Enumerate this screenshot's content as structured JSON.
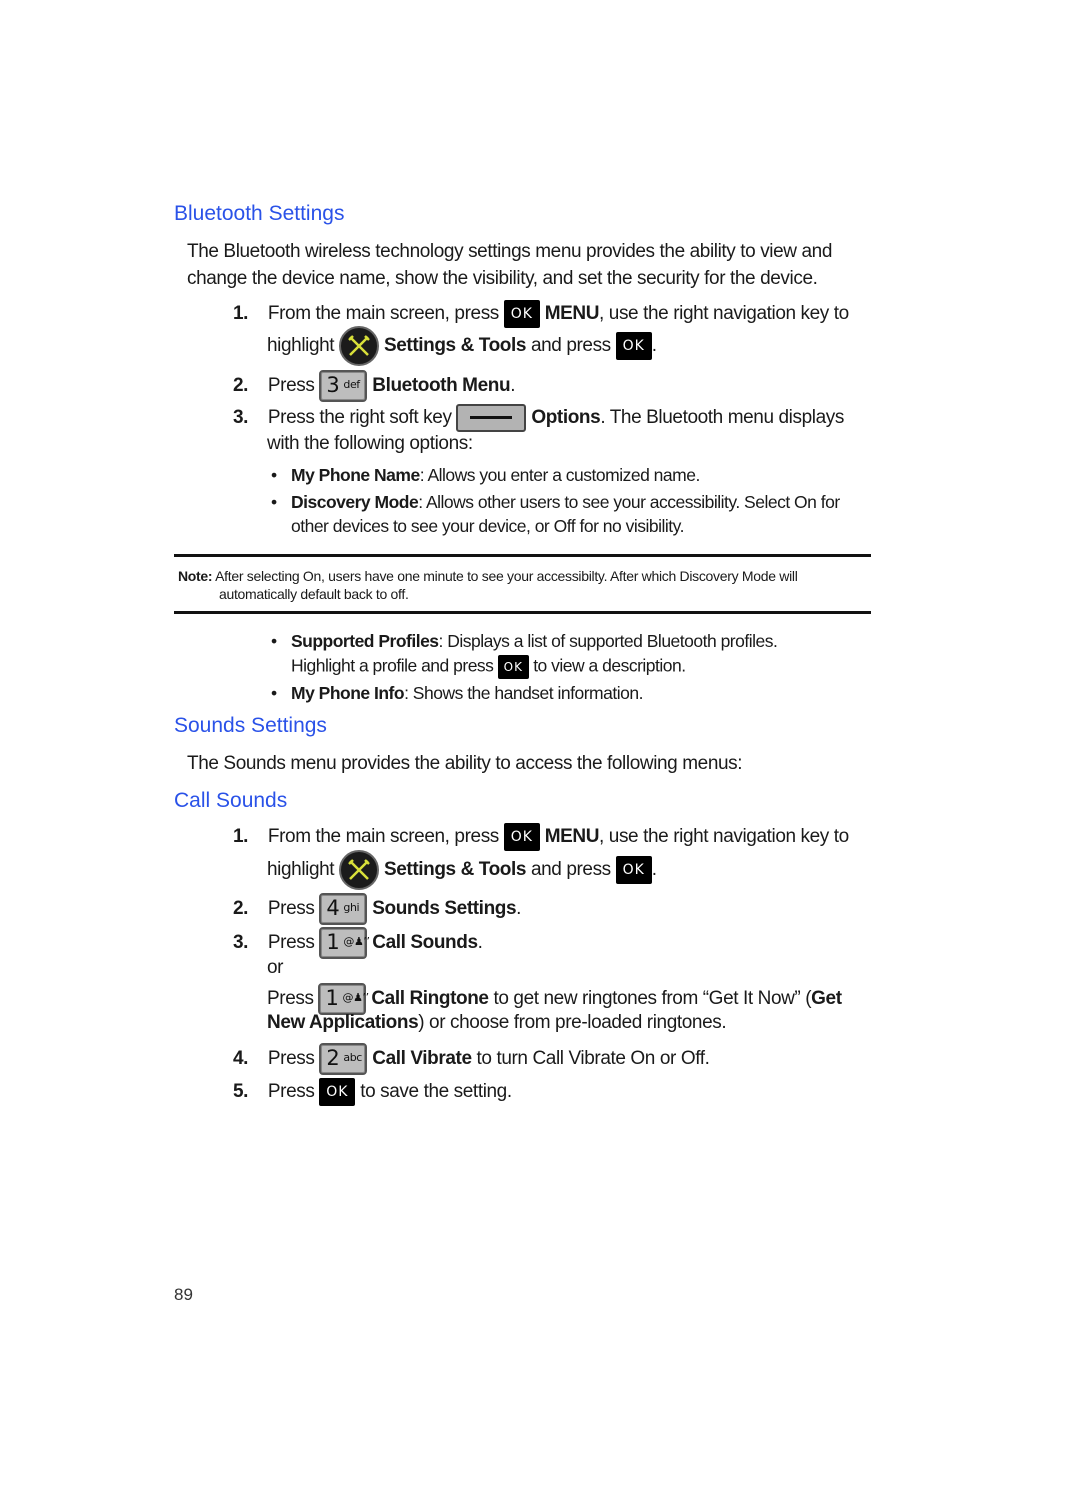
{
  "bluetooth": {
    "heading": "Bluetooth Settings",
    "intro_line1": "The Bluetooth wireless technology settings menu provides the ability to view and",
    "intro_line2": "change the device name, show the visibility, and set the security for the device.",
    "steps": [
      {
        "num": "1.",
        "line1_pre": "From the main screen, press",
        "ok_label": "OK",
        "line1_bold": "MENU",
        "line1_post": ", use the right navigation key to",
        "line2_pre": "highlight",
        "icon": "settings-tools-icon",
        "line2_bold": "Settings & Tools",
        "line2_post": " and press",
        "line2_end": "."
      },
      {
        "num": "2.",
        "pre": "Press",
        "key_main": "3",
        "key_sub": "def",
        "bold": "Bluetooth Menu",
        "post": "."
      },
      {
        "num": "3.",
        "pre": "Press the right soft key",
        "icon": "right-soft-key-icon",
        "bold": "Options",
        "post": ". The Bluetooth menu displays",
        "line2": "with the following options:"
      }
    ],
    "options": [
      {
        "name": "My Phone Name",
        "desc": ": Allows you enter a customized name."
      },
      {
        "name": "Discovery Mode",
        "desc": ": Allows other users to see your accessibility. Select On for",
        "desc2": "other devices to see your device, or Off for no visibility."
      },
      {
        "name": "Supported Profiles",
        "desc": ": Displays a list of supported Bluetooth profiles.",
        "desc2_pre": "Highlight a profile and press",
        "desc2_post": "to view a description."
      },
      {
        "name": "My Phone Info",
        "desc": ": Shows the handset information."
      }
    ],
    "note": {
      "label": "Note:",
      "line1": "After selecting On, users have one minute to see your accessibilty. After which Discovery Mode will",
      "line2": "automatically default back to off."
    }
  },
  "sounds": {
    "heading": "Sounds Settings",
    "intro": "The Sounds menu provides the ability to access the following menus:",
    "subheading": "Call Sounds",
    "steps": [
      {
        "num": "1.",
        "line1_pre": "From the main screen, press",
        "line1_bold": "MENU",
        "line1_post": ", use the right navigation key to",
        "line2_pre": "highlight",
        "line2_bold": "Settings & Tools",
        "line2_post": " and press",
        "line2_end": "."
      },
      {
        "num": "2.",
        "pre": "Press",
        "key_main": "4",
        "key_sub": "ghi",
        "bold": "Sounds Settings",
        "post": "."
      },
      {
        "num": "3.",
        "pre": "Press",
        "key_main": "1",
        "key_sub": "@♟’’",
        "bold": "Call Sounds",
        "post": "."
      },
      {
        "or": "or",
        "pre": "Press",
        "key_main": "1",
        "key_sub": "@♟’’",
        "bold": "Call Ringtone",
        "post": " to get new ringtones from “Get It Now” (",
        "bold2": "Get",
        "line2_bold": "New Applications",
        "line2_post": ") or choose from pre-loaded ringtones."
      },
      {
        "num": "4.",
        "pre": "Press",
        "key_main": "2",
        "key_sub": "abc",
        "bold": "Call Vibrate",
        "post": " to turn Call Vibrate On or Off."
      },
      {
        "num": "5.",
        "pre": "Press",
        "post": " to save the setting."
      }
    ]
  },
  "ok_label": "OK",
  "page_number": "89"
}
